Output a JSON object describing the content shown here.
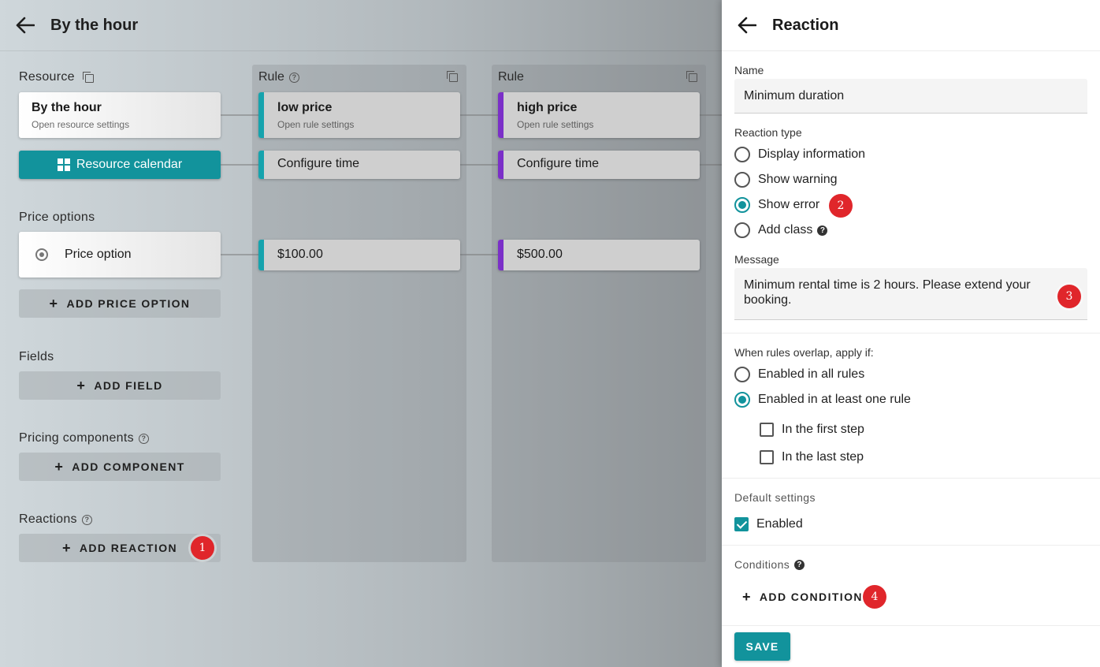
{
  "editor": {
    "title": "By the hour",
    "resource_label": "Resource",
    "resource_card": {
      "title": "By the hour",
      "subtitle": "Open resource settings"
    },
    "resource_calendar_label": "Resource calendar",
    "price_options_label": "Price options",
    "price_option_label": "Price option",
    "add_price_option_label": "ADD PRICE OPTION",
    "fields_label": "Fields",
    "add_field_label": "ADD FIELD",
    "pricing_components_label": "Pricing components",
    "add_component_label": "ADD COMPONENT",
    "reactions_label": "Reactions",
    "add_reaction_label": "ADD REACTION",
    "rules": [
      {
        "header": "Rule",
        "title": "low price",
        "subtitle": "Open rule settings",
        "configure_label": "Configure time",
        "price": "$100.00",
        "color": "#16a3ad"
      },
      {
        "header": "Rule",
        "title": "high price",
        "subtitle": "Open rule settings",
        "configure_label": "Configure time",
        "price": "$500.00",
        "color": "#7b2fc8"
      }
    ]
  },
  "panel": {
    "title": "Reaction",
    "name_label": "Name",
    "name_value": "Minimum duration",
    "reaction_type_label": "Reaction type",
    "reaction_types": [
      "Display information",
      "Show warning",
      "Show error",
      "Add class"
    ],
    "selected_reaction_type": "Show error",
    "message_label": "Message",
    "message_value": "Minimum rental time is 2 hours. Please extend your booking.",
    "overlap_label": "When rules overlap, apply if:",
    "overlap_options": [
      "Enabled in all rules",
      "Enabled in at least one rule"
    ],
    "selected_overlap": "Enabled in at least one rule",
    "step_options": [
      "In the first step",
      "In the last step"
    ],
    "default_settings_label": "Default settings",
    "enabled_label": "Enabled",
    "enabled_checked": true,
    "conditions_label": "Conditions",
    "add_condition_label": "ADD CONDITION",
    "save_label": "SAVE"
  },
  "badges": [
    "1",
    "2",
    "3",
    "4"
  ],
  "colors": {
    "accent": "#12939c",
    "badge": "#e0262b"
  }
}
